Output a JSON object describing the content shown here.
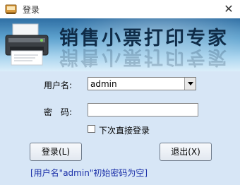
{
  "window": {
    "title": "登录",
    "close_glyph": "✕"
  },
  "banner": {
    "title": "销售小票打印专家",
    "image": "printer-icon"
  },
  "form": {
    "username_label": "用户名:",
    "username_value": "admin",
    "password_label": "密　码:",
    "password_value": "",
    "auto_login_label": "下次直接登录",
    "auto_login_checked": false
  },
  "buttons": {
    "login": "登录(L)",
    "exit": "退出(X)"
  },
  "hint": "[用户名\"admin\"初始密码为空]",
  "colors": {
    "background": "#d7e6f6",
    "hint_text": "#1a2fa8",
    "banner_top": "#2f6fa4",
    "banner_bottom": "#dbeefa"
  }
}
